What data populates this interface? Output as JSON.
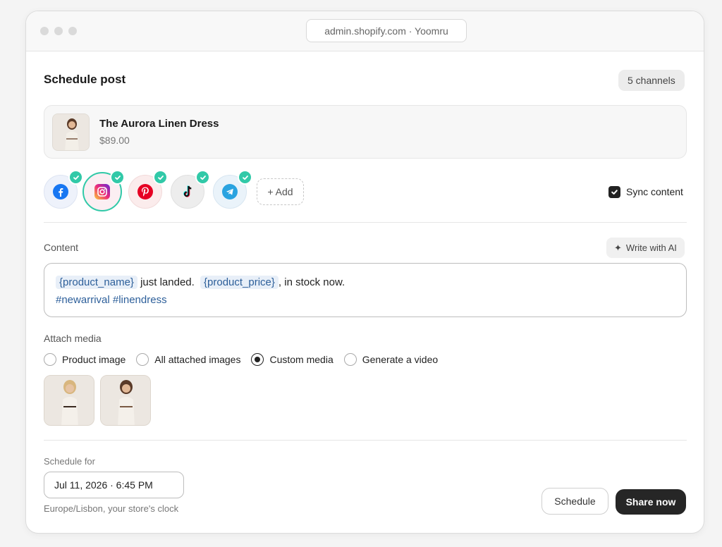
{
  "browser": {
    "url": "admin.shopify.com · Yoomru"
  },
  "header": {
    "title": "Schedule post",
    "channels_badge": "5 channels"
  },
  "product": {
    "name": "The Aurora Linen Dress",
    "price": "$89.00"
  },
  "channels": [
    {
      "name": "facebook",
      "icon": "facebook-icon",
      "selected": true,
      "color": "#1877f2"
    },
    {
      "name": "instagram",
      "icon": "instagram-icon",
      "selected": true,
      "color": "#e4405f"
    },
    {
      "name": "pinterest",
      "icon": "pinterest-icon",
      "selected": true,
      "color": "#e60023"
    },
    {
      "name": "tiktok",
      "icon": "tiktok-icon",
      "selected": true,
      "color": "#111111"
    },
    {
      "name": "telegram",
      "icon": "telegram-icon",
      "selected": true,
      "color": "#2aa3e0"
    }
  ],
  "add_channel_label": "+ Add",
  "sync": {
    "label": "Sync content",
    "checked": true
  },
  "content": {
    "label": "Content",
    "ai_button": "Write with AI",
    "token_name": "{product_name}",
    "text_1": "just landed.",
    "token_price": "{product_price}",
    "text_2": ", in stock now.",
    "hashtags": "#newarrival #linendress"
  },
  "attach_media": {
    "label": "Attach media",
    "options": [
      "Product image",
      "All attached images",
      "Custom media",
      "Generate a video"
    ],
    "selected": "Custom media"
  },
  "schedule": {
    "label": "Schedule for",
    "datetime": "Jul 11, 2026 · 6:45 PM",
    "timezone_note": "Europe/Lisbon, your store's clock"
  },
  "actions": {
    "schedule": "Schedule",
    "share_now": "Share now"
  },
  "colors": {
    "accent_check": "#31c9a8",
    "primary_button": "#262626",
    "token_bg": "#e8eff8",
    "token_text": "#2d5f9a"
  }
}
